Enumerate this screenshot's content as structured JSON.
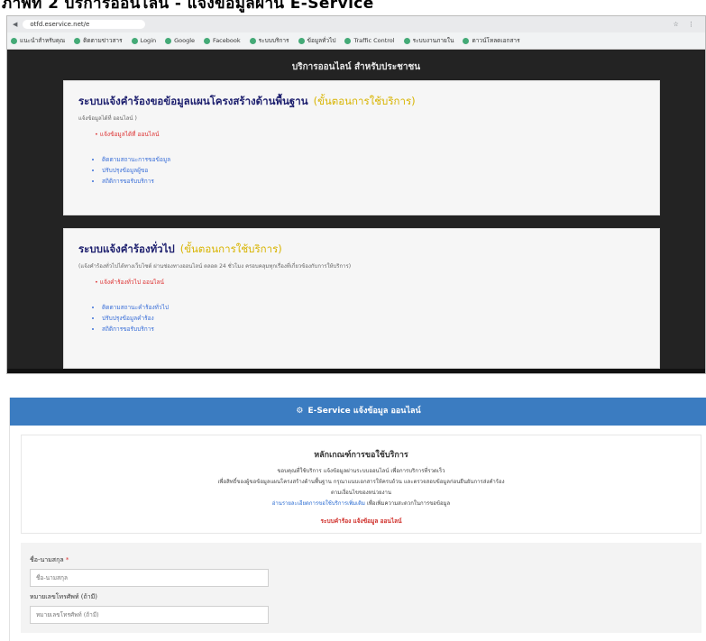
{
  "heading": "ภาพที่ 2 บริการออนไลน์ - แจ้งข้อมูลผ่าน E-Service",
  "browser": {
    "address": "otfd.eservice.net/e",
    "bookmarks": [
      "แนะนำสำหรับคุณ",
      "ติดตามข่าวสาร",
      "Login",
      "Google",
      "Facebook",
      "ระบบบริการ",
      "ข้อมูลทั่วไป",
      "Traffic Control",
      "ระบบงานภายใน",
      "ดาวน์โหลดเอกสาร"
    ]
  },
  "services_page": {
    "title": "บริการออนไลน์ สำหรับประชาชน",
    "card1": {
      "title": "ระบบแจ้งคำร้องขอข้อมูลแผนโครงสร้างด้านพื้นฐาน",
      "subtitle": "(ขั้นตอนการใช้บริการ)",
      "desc": "แจ้งข้อมูลได้ที่ ออนไลน์ )",
      "red_link": "แจ้งข้อมูลได้ที่ ออนไลน์",
      "links": [
        "ติดตามสถานะการขอข้อมูล",
        "ปรับปรุงข้อมูลผู้ขอ",
        "สถิติการขอรับบริการ"
      ]
    },
    "card2": {
      "title": "ระบบแจ้งคำร้องทั่วไป",
      "subtitle": "(ขั้นตอนการใช้บริการ)",
      "desc": "(แจ้งคำร้องทั่วไปได้ทางเว็บไซต์ ผ่านช่องทางออนไลน์ ตลอด 24 ชั่วโมง ครอบคลุมทุกเรื่องที่เกี่ยวข้องกับการให้บริการ)",
      "red_link": "แจ้งคำร้องทั่วไป ออนไลน์",
      "links": [
        "ติดตามสถานะคำร้องทั่วไป",
        "ปรับปรุงข้อมูลคำร้อง",
        "สถิติการขอรับบริการ"
      ]
    }
  },
  "form_page": {
    "header": "E-Service แจ้งข้อมูล ออนไลน์",
    "notice_title": "หลักเกณฑ์การขอใช้บริการ",
    "notice_lines": [
      "ขอบคุณที่ใช้บริการ แจ้งข้อมูลผ่านระบบออนไลน์ เพื่อการบริการที่รวดเร็ว",
      "เพื่อสิทธิ์ของผู้ขอข้อมูลแผนโครงสร้างด้านพื้นฐาน กรุณาแนบเอกสารให้ครบถ้วน และตรวจสอบข้อมูลก่อนยืนยันการส่งคำร้อง",
      "ตามเงื่อนไขของหน่วยงาน"
    ],
    "notice_link": "อ่านรายละเอียดการขอใช้บริการเพิ่มเติม",
    "notice_link_tail": "เพื่อเพิ่มความสะดวกในการขอข้อมูล",
    "notice_red": "ระบบคำร้อง แจ้งข้อมูล ออนไลน์",
    "field1": {
      "label": "ชื่อ-นามสกุล",
      "required": "*",
      "placeholder": "ชื่อ-นามสกุล"
    },
    "field2": {
      "label": "หมายเลขโทรศัพท์ (ถ้ามี)",
      "placeholder": "หมายเลขโทรศัพท์ (ถ้ามี)"
    }
  }
}
